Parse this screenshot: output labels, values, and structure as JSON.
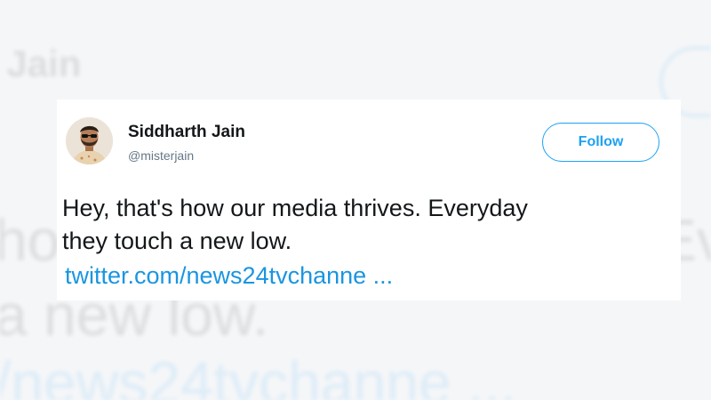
{
  "tweet": {
    "author_name": "Siddharth Jain",
    "author_handle": "@misterjain",
    "follow_label": "Follow",
    "text_line1": "Hey, that's how our media thrives. Everyday",
    "text_line2": "they touch a new low.",
    "link_text": "twitter.com/news24tvchanne ..."
  },
  "background": {
    "name_fragment": "h Jain",
    "line1_fragment": "ho",
    "line1_right_fragment": "Ev",
    "line2_fragment": "a new low.",
    "link_fragment": "/news24tvchanne ..."
  },
  "colors": {
    "brand": "#1da1f2",
    "link": "#1b95e0",
    "text": "#14171a",
    "muted": "#657786"
  },
  "icons": {
    "avatar": "profile-photo"
  }
}
